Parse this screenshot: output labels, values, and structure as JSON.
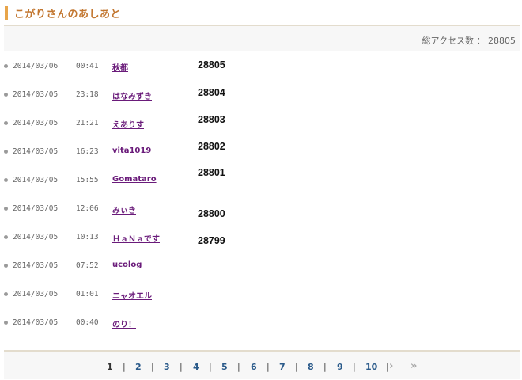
{
  "header": {
    "title": "こがりさんのあしあと"
  },
  "access": {
    "label": "総アクセス数 ： 28805"
  },
  "rows": [
    {
      "date": "2014/03/06",
      "time": "00:41",
      "user": "秋都"
    },
    {
      "date": "2014/03/05",
      "time": "23:18",
      "user": "はなみずき"
    },
    {
      "date": "2014/03/05",
      "time": "21:21",
      "user": "えありす"
    },
    {
      "date": "2014/03/05",
      "time": "16:23",
      "user": "vita1019"
    },
    {
      "date": "2014/03/05",
      "time": "15:55",
      "user": "Gomataro"
    },
    {
      "date": "2014/03/05",
      "time": "12:06",
      "user": "みぃき"
    },
    {
      "date": "2014/03/05",
      "time": "10:13",
      "user": "ＨａＮａです"
    },
    {
      "date": "2014/03/05",
      "time": "07:52",
      "user": "ucolog"
    },
    {
      "date": "2014/03/05",
      "time": "01:01",
      "user": "ニャオエル"
    },
    {
      "date": "2014/03/05",
      "time": "00:40",
      "user": "のり！"
    }
  ],
  "counts": [
    "28805",
    "28804",
    "28803",
    "28802",
    "28801",
    "28800",
    "28799"
  ],
  "pagination": {
    "current": "1",
    "pages": [
      "2",
      "3",
      "4",
      "5",
      "6",
      "7",
      "8",
      "9",
      "10"
    ],
    "separator": "|",
    "next_icon": "»-next-icon",
    "last_icon": "»-last-icon"
  }
}
